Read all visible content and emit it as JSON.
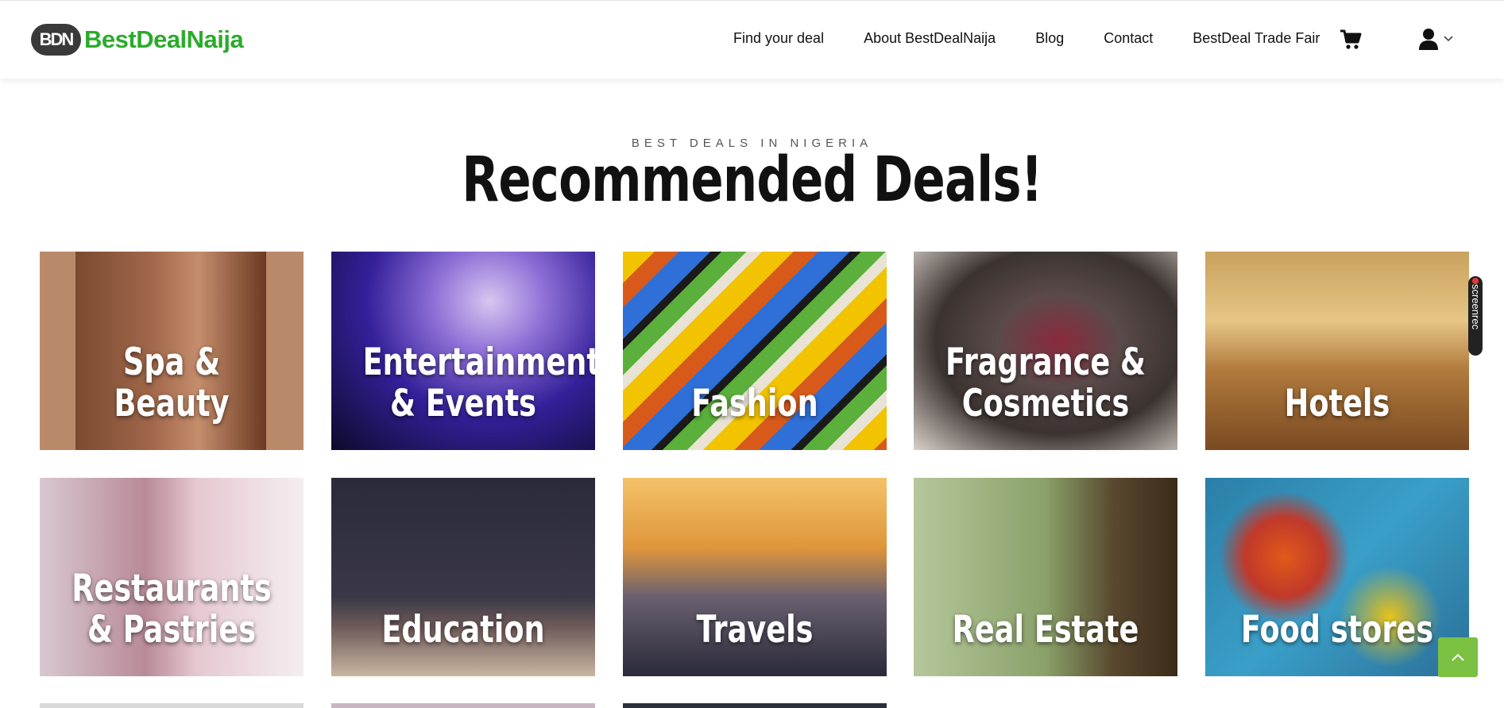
{
  "header": {
    "logo_badge": "BDN",
    "logo_text": "BestDealNaija",
    "nav": [
      "Find your deal",
      "About BestDealNaija",
      "Blog",
      "Contact",
      "BestDeal Trade Fair"
    ],
    "cart_icon": "cart-icon",
    "user_icon": "user-icon"
  },
  "hero": {
    "eyebrow": "BEST DEALS IN NIGERIA",
    "title": "Recommended Deals!"
  },
  "categories": [
    {
      "label": "Spa & Beauty"
    },
    {
      "label": "Entertainment & Events"
    },
    {
      "label": "Fashion"
    },
    {
      "label": "Fragrance & Cosmetics"
    },
    {
      "label": "Hotels"
    },
    {
      "label": "Restaurants & Pastries"
    },
    {
      "label": "Education"
    },
    {
      "label": "Travels"
    },
    {
      "label": "Real Estate"
    },
    {
      "label": "Food stores"
    }
  ],
  "overlay": {
    "screenrec": "screenrec",
    "scroll_top_icon": "chevron-up-icon"
  },
  "colors": {
    "brand_green": "#2bab2b",
    "scroll_button": "#7bc142"
  }
}
